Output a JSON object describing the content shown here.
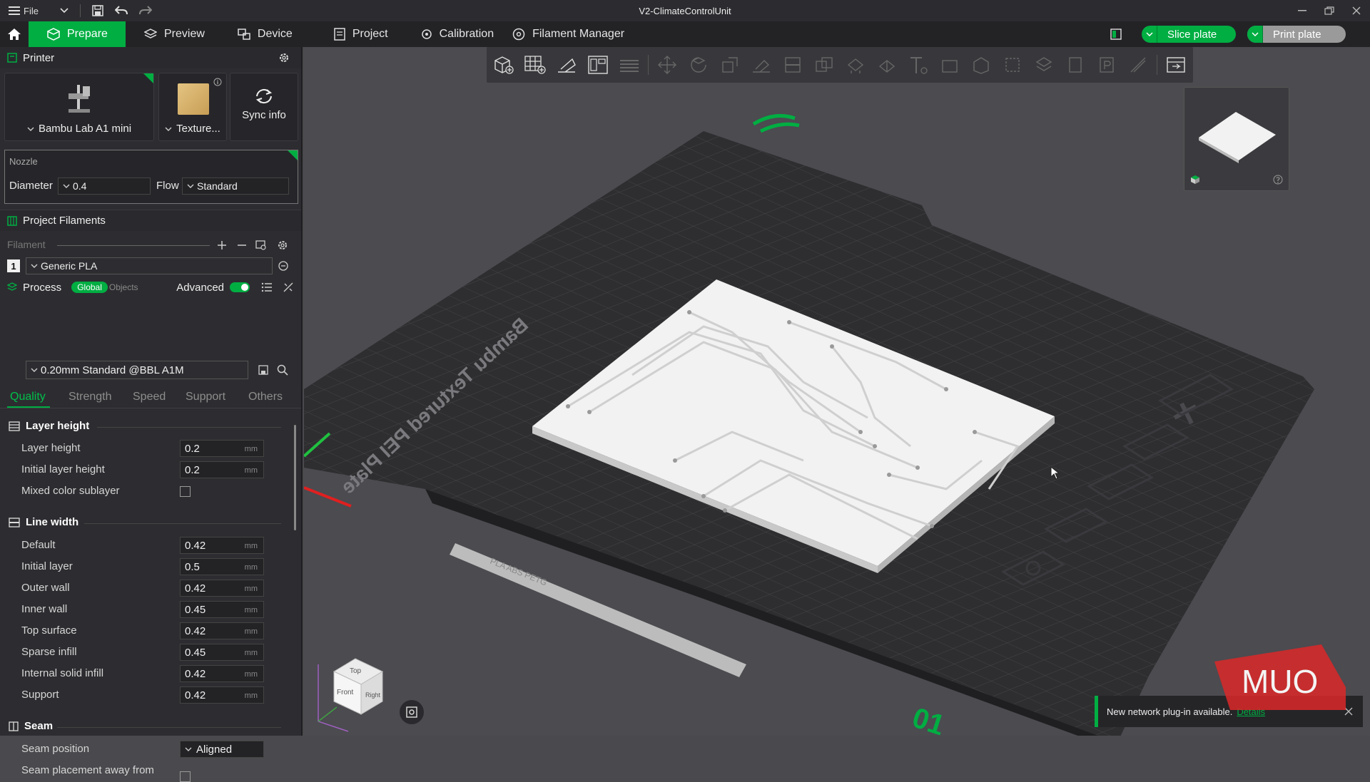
{
  "titlebar": {
    "file_label": "File",
    "title": "V2-ClimateControlUnit"
  },
  "nav": {
    "tabs": [
      {
        "label": "Prepare"
      },
      {
        "label": "Preview"
      },
      {
        "label": "Device"
      },
      {
        "label": "Project"
      },
      {
        "label": "Calibration"
      },
      {
        "label": "Filament Manager"
      }
    ],
    "slice_label": "Slice plate",
    "print_label": "Print plate"
  },
  "printer": {
    "header": "Printer",
    "printer_name": "Bambu Lab A1 mini",
    "plate_name": "Texture...",
    "sync_label": "Sync info"
  },
  "nozzle": {
    "header": "Nozzle",
    "diameter_label": "Diameter",
    "diameter_value": "0.4",
    "flow_label": "Flow",
    "flow_value": "Standard"
  },
  "filaments": {
    "header": "Project Filaments",
    "filament_label": "Filament",
    "slot_number": "1",
    "material": "Generic PLA"
  },
  "process": {
    "header": "Process",
    "global_label": "Global",
    "objects_label": "Objects",
    "advanced_label": "Advanced",
    "preset": "0.20mm Standard @BBL A1M"
  },
  "subtabs": [
    "Quality",
    "Strength",
    "Speed",
    "Support",
    "Others"
  ],
  "layer_height": {
    "title": "Layer height",
    "rows": [
      {
        "label": "Layer height",
        "value": "0.2",
        "unit": "mm"
      },
      {
        "label": "Initial layer height",
        "value": "0.2",
        "unit": "mm"
      }
    ],
    "mixed_label": "Mixed color sublayer"
  },
  "line_width": {
    "title": "Line width",
    "rows": [
      {
        "label": "Default",
        "value": "0.42",
        "unit": "mm"
      },
      {
        "label": "Initial layer",
        "value": "0.5",
        "unit": "mm"
      },
      {
        "label": "Outer wall",
        "value": "0.42",
        "unit": "mm"
      },
      {
        "label": "Inner wall",
        "value": "0.45",
        "unit": "mm"
      },
      {
        "label": "Top surface",
        "value": "0.42",
        "unit": "mm"
      },
      {
        "label": "Sparse infill",
        "value": "0.45",
        "unit": "mm"
      },
      {
        "label": "Internal solid infill",
        "value": "0.42",
        "unit": "mm"
      },
      {
        "label": "Support",
        "value": "0.42",
        "unit": "mm"
      }
    ]
  },
  "seam": {
    "title": "Seam",
    "position_label": "Seam position",
    "position_value": "Aligned",
    "away_label": "Seam placement away from"
  },
  "viewport": {
    "plate_text": "Bambu Textured PEI Plate",
    "plate_number": "01",
    "plate_strip": "PLA  ABS  PETG",
    "cube_top": "Top",
    "cube_front": "Front",
    "cube_right": "Right"
  },
  "notification": {
    "text": "New network plug-in available.",
    "link": "Details"
  },
  "watermark": "MUO",
  "colors": {
    "accent": "#00ae42",
    "plate": "#2e2e30",
    "background": "#4b4b50"
  }
}
